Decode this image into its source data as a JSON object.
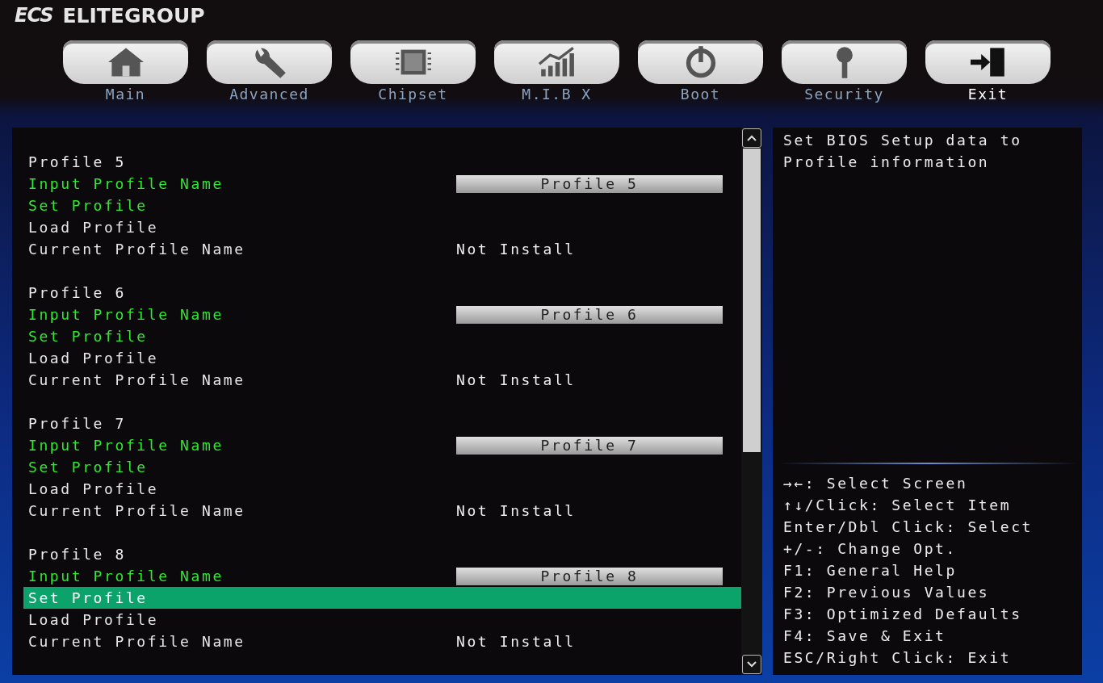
{
  "logo": {
    "mark": "ECS",
    "name": "ELITEGROUP"
  },
  "tabs": [
    {
      "label": "Main",
      "selected": false
    },
    {
      "label": "Advanced",
      "selected": false
    },
    {
      "label": "Chipset",
      "selected": false
    },
    {
      "label": "M.I.B X",
      "selected": false
    },
    {
      "label": "Boot",
      "selected": false
    },
    {
      "label": "Security",
      "selected": false
    },
    {
      "label": "Exit",
      "selected": true
    }
  ],
  "settings": {
    "groups": [
      {
        "title": "Profile 5",
        "items": [
          {
            "label": "Input Profile Name",
            "kind": "field",
            "value": "Profile 5",
            "selectable": true,
            "selected": false
          },
          {
            "label": "Set Profile",
            "kind": "action",
            "selectable": true,
            "selected": false
          },
          {
            "label": "Load Profile",
            "kind": "action",
            "selectable": false,
            "selected": false
          },
          {
            "label": "Current Profile Name",
            "kind": "info",
            "value": "Not Install",
            "selectable": false,
            "selected": false
          }
        ]
      },
      {
        "title": "Profile 6",
        "items": [
          {
            "label": "Input Profile Name",
            "kind": "field",
            "value": "Profile 6",
            "selectable": true,
            "selected": false
          },
          {
            "label": "Set Profile",
            "kind": "action",
            "selectable": true,
            "selected": false
          },
          {
            "label": "Load Profile",
            "kind": "action",
            "selectable": false,
            "selected": false
          },
          {
            "label": "Current Profile Name",
            "kind": "info",
            "value": "Not Install",
            "selectable": false,
            "selected": false
          }
        ]
      },
      {
        "title": "Profile 7",
        "items": [
          {
            "label": "Input Profile Name",
            "kind": "field",
            "value": "Profile 7",
            "selectable": true,
            "selected": false
          },
          {
            "label": "Set Profile",
            "kind": "action",
            "selectable": true,
            "selected": false
          },
          {
            "label": "Load Profile",
            "kind": "action",
            "selectable": false,
            "selected": false
          },
          {
            "label": "Current Profile Name",
            "kind": "info",
            "value": "Not Install",
            "selectable": false,
            "selected": false
          }
        ]
      },
      {
        "title": "Profile 8",
        "items": [
          {
            "label": "Input Profile Name",
            "kind": "field",
            "value": "Profile 8",
            "selectable": true,
            "selected": false
          },
          {
            "label": "Set Profile",
            "kind": "action",
            "selectable": true,
            "selected": true
          },
          {
            "label": "Load Profile",
            "kind": "action",
            "selectable": false,
            "selected": false
          },
          {
            "label": "Current Profile Name",
            "kind": "info",
            "value": "Not Install",
            "selectable": false,
            "selected": false
          }
        ]
      }
    ]
  },
  "help": {
    "description": "Set BIOS Setup data to Profile information",
    "keys": [
      "→←: Select Screen",
      "↑↓/Click: Select Item",
      "Enter/Dbl Click: Select",
      "+/-: Change Opt.",
      "F1: General Help",
      "F2: Previous Values",
      "F3: Optimized Defaults",
      "F4: Save & Exit",
      "ESC/Right Click: Exit"
    ]
  }
}
